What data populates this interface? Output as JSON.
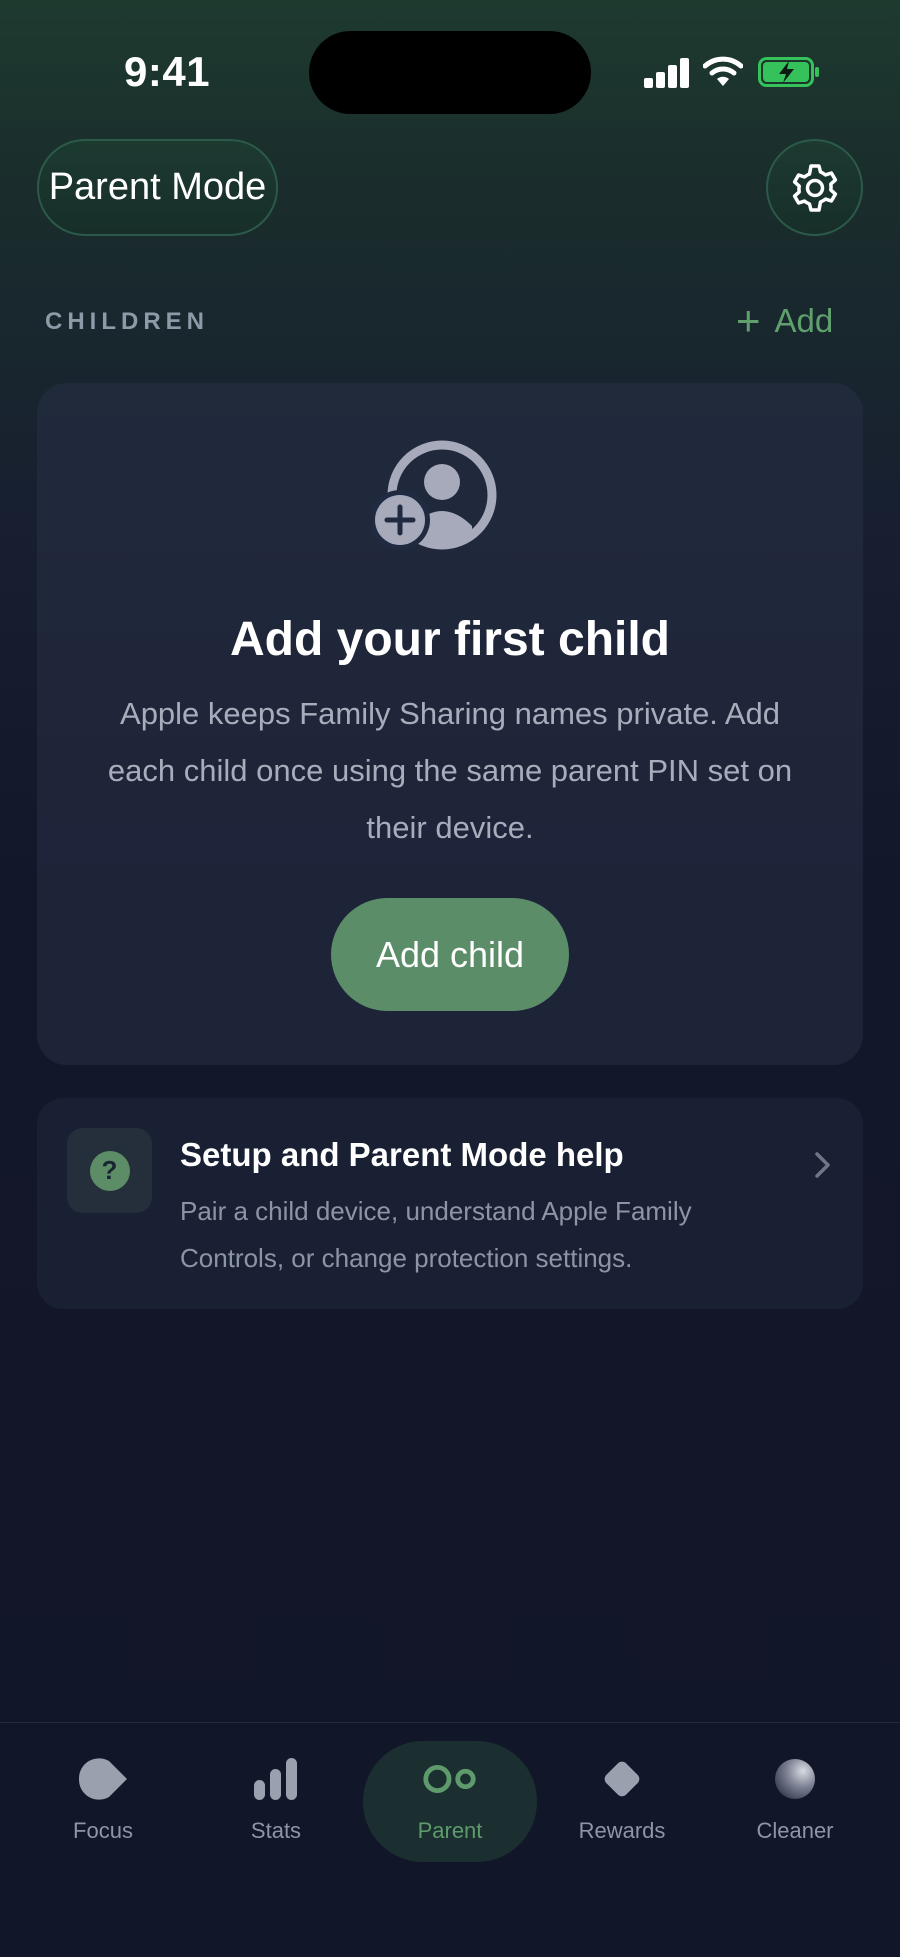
{
  "status_bar": {
    "time": "9:41",
    "icons": [
      "signal-icon",
      "wifi-icon",
      "battery-charging-icon"
    ]
  },
  "header": {
    "mode_label": "Parent Mode",
    "settings_icon": "gear-icon"
  },
  "children_section": {
    "label": "CHILDREN",
    "add_label": "Add"
  },
  "empty_state": {
    "icon": "add-person-icon",
    "title": "Add your first child",
    "description": "Apple keeps Family Sharing names private. Add each child once using the same parent PIN set on their device.",
    "button_label": "Add child"
  },
  "help_card": {
    "icon": "question-icon",
    "title": "Setup and Parent Mode help",
    "description": "Pair a child device, understand Apple Family Controls, or change protection settings."
  },
  "tab_bar": {
    "tabs": [
      {
        "label": "Focus",
        "icon": "focus-icon"
      },
      {
        "label": "Stats",
        "icon": "stats-icon"
      },
      {
        "label": "Parent",
        "icon": "parent-icon",
        "active": true
      },
      {
        "label": "Rewards",
        "icon": "rewards-icon"
      },
      {
        "label": "Cleaner",
        "icon": "cleaner-icon"
      }
    ]
  },
  "colors": {
    "accent": "#5b8d69",
    "accent_text": "#5fa06d",
    "background": "#111628",
    "card": "#1a2033"
  }
}
